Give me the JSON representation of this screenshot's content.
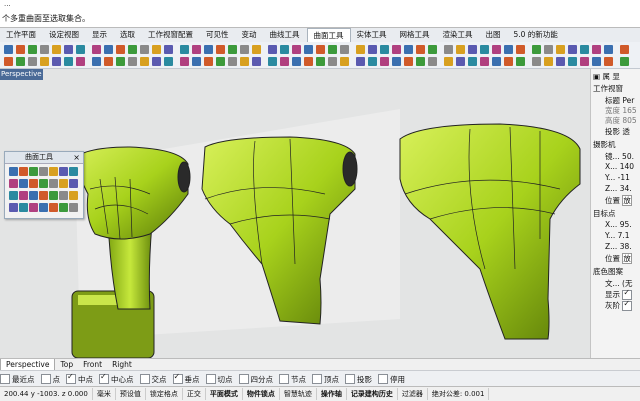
{
  "command": {
    "history": "...",
    "prompt": "个多重曲面至选取集合。"
  },
  "menu_tabs": [
    {
      "label": "工作平面"
    },
    {
      "label": "设定视图"
    },
    {
      "label": "显示"
    },
    {
      "label": "选取"
    },
    {
      "label": "工作视窗配置"
    },
    {
      "label": "可见性"
    },
    {
      "label": "变动"
    },
    {
      "label": "曲线工具"
    },
    {
      "label": "曲面工具"
    },
    {
      "label": "实体工具"
    },
    {
      "label": "网格工具"
    },
    {
      "label": "渲染工具"
    },
    {
      "label": "出图"
    },
    {
      "label": "5.0 的新功能"
    }
  ],
  "viewport": {
    "title": "Perspective",
    "dropdown_icon": "chevron-down-icon",
    "bg_color": "#e3e4e4",
    "object_color": "#a8d21c"
  },
  "floating_panel": {
    "title": "曲面工具",
    "close_label": "×"
  },
  "properties": {
    "section_viewport": "工作视窗",
    "title_label": "标题",
    "title_value": "Per",
    "width_label": "宽度",
    "width_value": "165",
    "height_label": "高度",
    "height_value": "805",
    "projection_label": "投影",
    "projection_value": "透",
    "section_camera": "摄影机",
    "lens_label": "镜...",
    "lens_value": "50.",
    "cam_x_label": "X...",
    "cam_x_value": "140",
    "cam_y_label": "Y...",
    "cam_y_value": "-11",
    "cam_z_label": "Z...",
    "cam_z_value": "34.",
    "cam_pos_label": "位置",
    "cam_pos_value": "放",
    "section_target": "目标点",
    "tgt_x_label": "X...",
    "tgt_x_value": "95.",
    "tgt_y_label": "Y...",
    "tgt_y_value": "7.1",
    "tgt_z_label": "Z...",
    "tgt_z_value": "38.",
    "tgt_pos_label": "位置",
    "tgt_pos_value": "放",
    "section_bg": "底色图案",
    "file_label": "文...",
    "file_value": "(无",
    "show_label": "显示",
    "gray_label": "灰阶"
  },
  "view_tabs": [
    {
      "label": "Perspective"
    },
    {
      "label": "Top"
    },
    {
      "label": "Front"
    },
    {
      "label": "Right"
    }
  ],
  "osnaps": [
    {
      "label": "最近点",
      "checked": false
    },
    {
      "label": "点",
      "checked": false
    },
    {
      "label": "中点",
      "checked": true
    },
    {
      "label": "中心点",
      "checked": true
    },
    {
      "label": "交点",
      "checked": false
    },
    {
      "label": "垂点",
      "checked": true
    },
    {
      "label": "切点",
      "checked": false
    },
    {
      "label": "四分点",
      "checked": false
    },
    {
      "label": "节点",
      "checked": false
    },
    {
      "label": "顶点",
      "checked": false
    },
    {
      "label": "投影",
      "checked": false
    },
    {
      "label": "停用",
      "checked": false
    }
  ],
  "status": {
    "coords": "200.44 y -1003. z 0.000",
    "unit": "毫米",
    "layer": "预设值",
    "lock_grid": "锁定格点",
    "ortho": "正交",
    "planar": "平面模式",
    "osnap": "物件锁点",
    "smart_track": "智慧轨迹",
    "gumball": "操作轴",
    "history": "记录建构历史",
    "filter": "过滤器",
    "tolerance": "绝对公差: 0.001"
  }
}
